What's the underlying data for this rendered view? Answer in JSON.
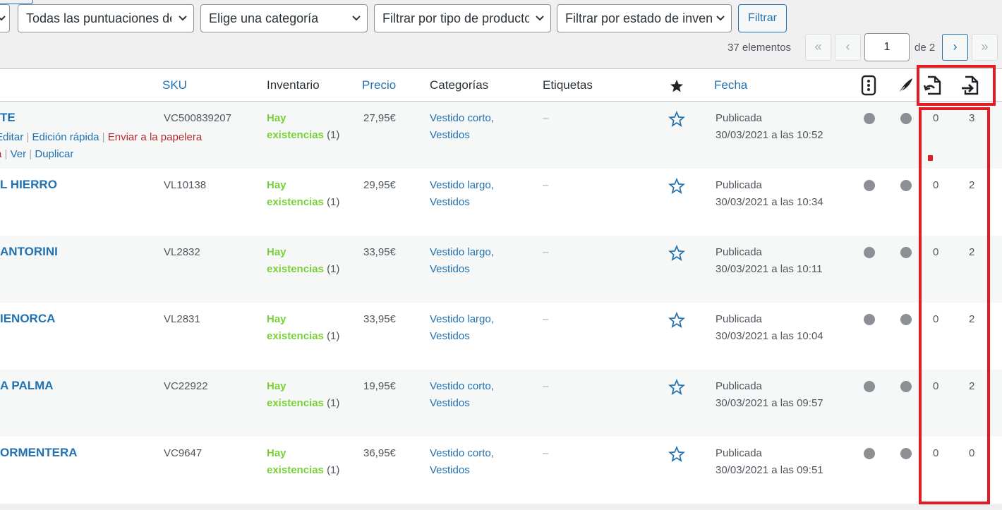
{
  "filters": {
    "rating": "Todas las puntuaciones de",
    "category": "Elige una categoría",
    "product_type": "Filtrar por tipo de producto",
    "stock_status": "Filtrar por estado de inventario",
    "button": "Filtrar"
  },
  "pagination": {
    "count": "37 elementos",
    "first": "«",
    "prev": "‹",
    "current_page": "1",
    "of_total": "de 2",
    "next": "›",
    "last": "»"
  },
  "columns": {
    "sku": "SKU",
    "stock": "Inventario",
    "price": "Precio",
    "categories": "Categorías",
    "tags": "Etiquetas",
    "featured_icon": "star-filled-icon",
    "date": "Fecha",
    "col_a_icon": "phone-icon",
    "col_b_icon": "feather-icon",
    "col_c_icon": "import-document-icon",
    "col_d_icon": "export-document-icon"
  },
  "row_actions": {
    "edit": "Editar",
    "quick_edit": "Edición rápida",
    "trash": "Enviar a la papelera",
    "view": "Ver",
    "duplicate": "Duplicar"
  },
  "rows": [
    {
      "title": "TE",
      "sku": "VC500839207",
      "stock_label": "Hay",
      "stock_label2": "existencias",
      "stock_qty": "(1)",
      "price": "27,95€",
      "cat1": "Vestido corto,",
      "cat2": "Vestidos",
      "tags": "–",
      "status": "Publicada",
      "date": "30/03/2021 a las 10:52",
      "a": "0",
      "b": "3"
    },
    {
      "title": "L HIERRO",
      "sku": "VL10138",
      "stock_label": "Hay",
      "stock_label2": "existencias",
      "stock_qty": "(1)",
      "price": "29,95€",
      "cat1": "Vestido largo,",
      "cat2": "Vestidos",
      "tags": "–",
      "status": "Publicada",
      "date": "30/03/2021 a las 10:34",
      "a": "0",
      "b": "2"
    },
    {
      "title": "ANTORINI",
      "sku": "VL2832",
      "stock_label": "Hay",
      "stock_label2": "existencias",
      "stock_qty": "(1)",
      "price": "33,95€",
      "cat1": "Vestido largo,",
      "cat2": "Vestidos",
      "tags": "–",
      "status": "Publicada",
      "date": "30/03/2021 a las 10:11",
      "a": "0",
      "b": "2"
    },
    {
      "title": "IENORCA",
      "sku": "VL2831",
      "stock_label": "Hay",
      "stock_label2": "existencias",
      "stock_qty": "(1)",
      "price": "33,95€",
      "cat1": "Vestido largo,",
      "cat2": "Vestidos",
      "tags": "–",
      "status": "Publicada",
      "date": "30/03/2021 a las 10:04",
      "a": "0",
      "b": "2"
    },
    {
      "title": "A PALMA",
      "sku": "VC22922",
      "stock_label": "Hay",
      "stock_label2": "existencias",
      "stock_qty": "(1)",
      "price": "19,95€",
      "cat1": "Vestido corto,",
      "cat2": "Vestidos",
      "tags": "–",
      "status": "Publicada",
      "date": "30/03/2021 a las 09:57",
      "a": "0",
      "b": "2"
    },
    {
      "title": "ORMENTERA",
      "sku": "VC9647",
      "stock_label": "Hay",
      "stock_label2": "existencias",
      "stock_qty": "(1)",
      "price": "36,95€",
      "cat1": "Vestido corto,",
      "cat2": "Vestidos",
      "tags": "–",
      "status": "Publicada",
      "date": "30/03/2021 a las 09:51",
      "a": "0",
      "b": "0"
    }
  ],
  "colors": {
    "link": "#2271b1",
    "in_stock": "#7ad03a",
    "highlight": "#e31b23"
  }
}
